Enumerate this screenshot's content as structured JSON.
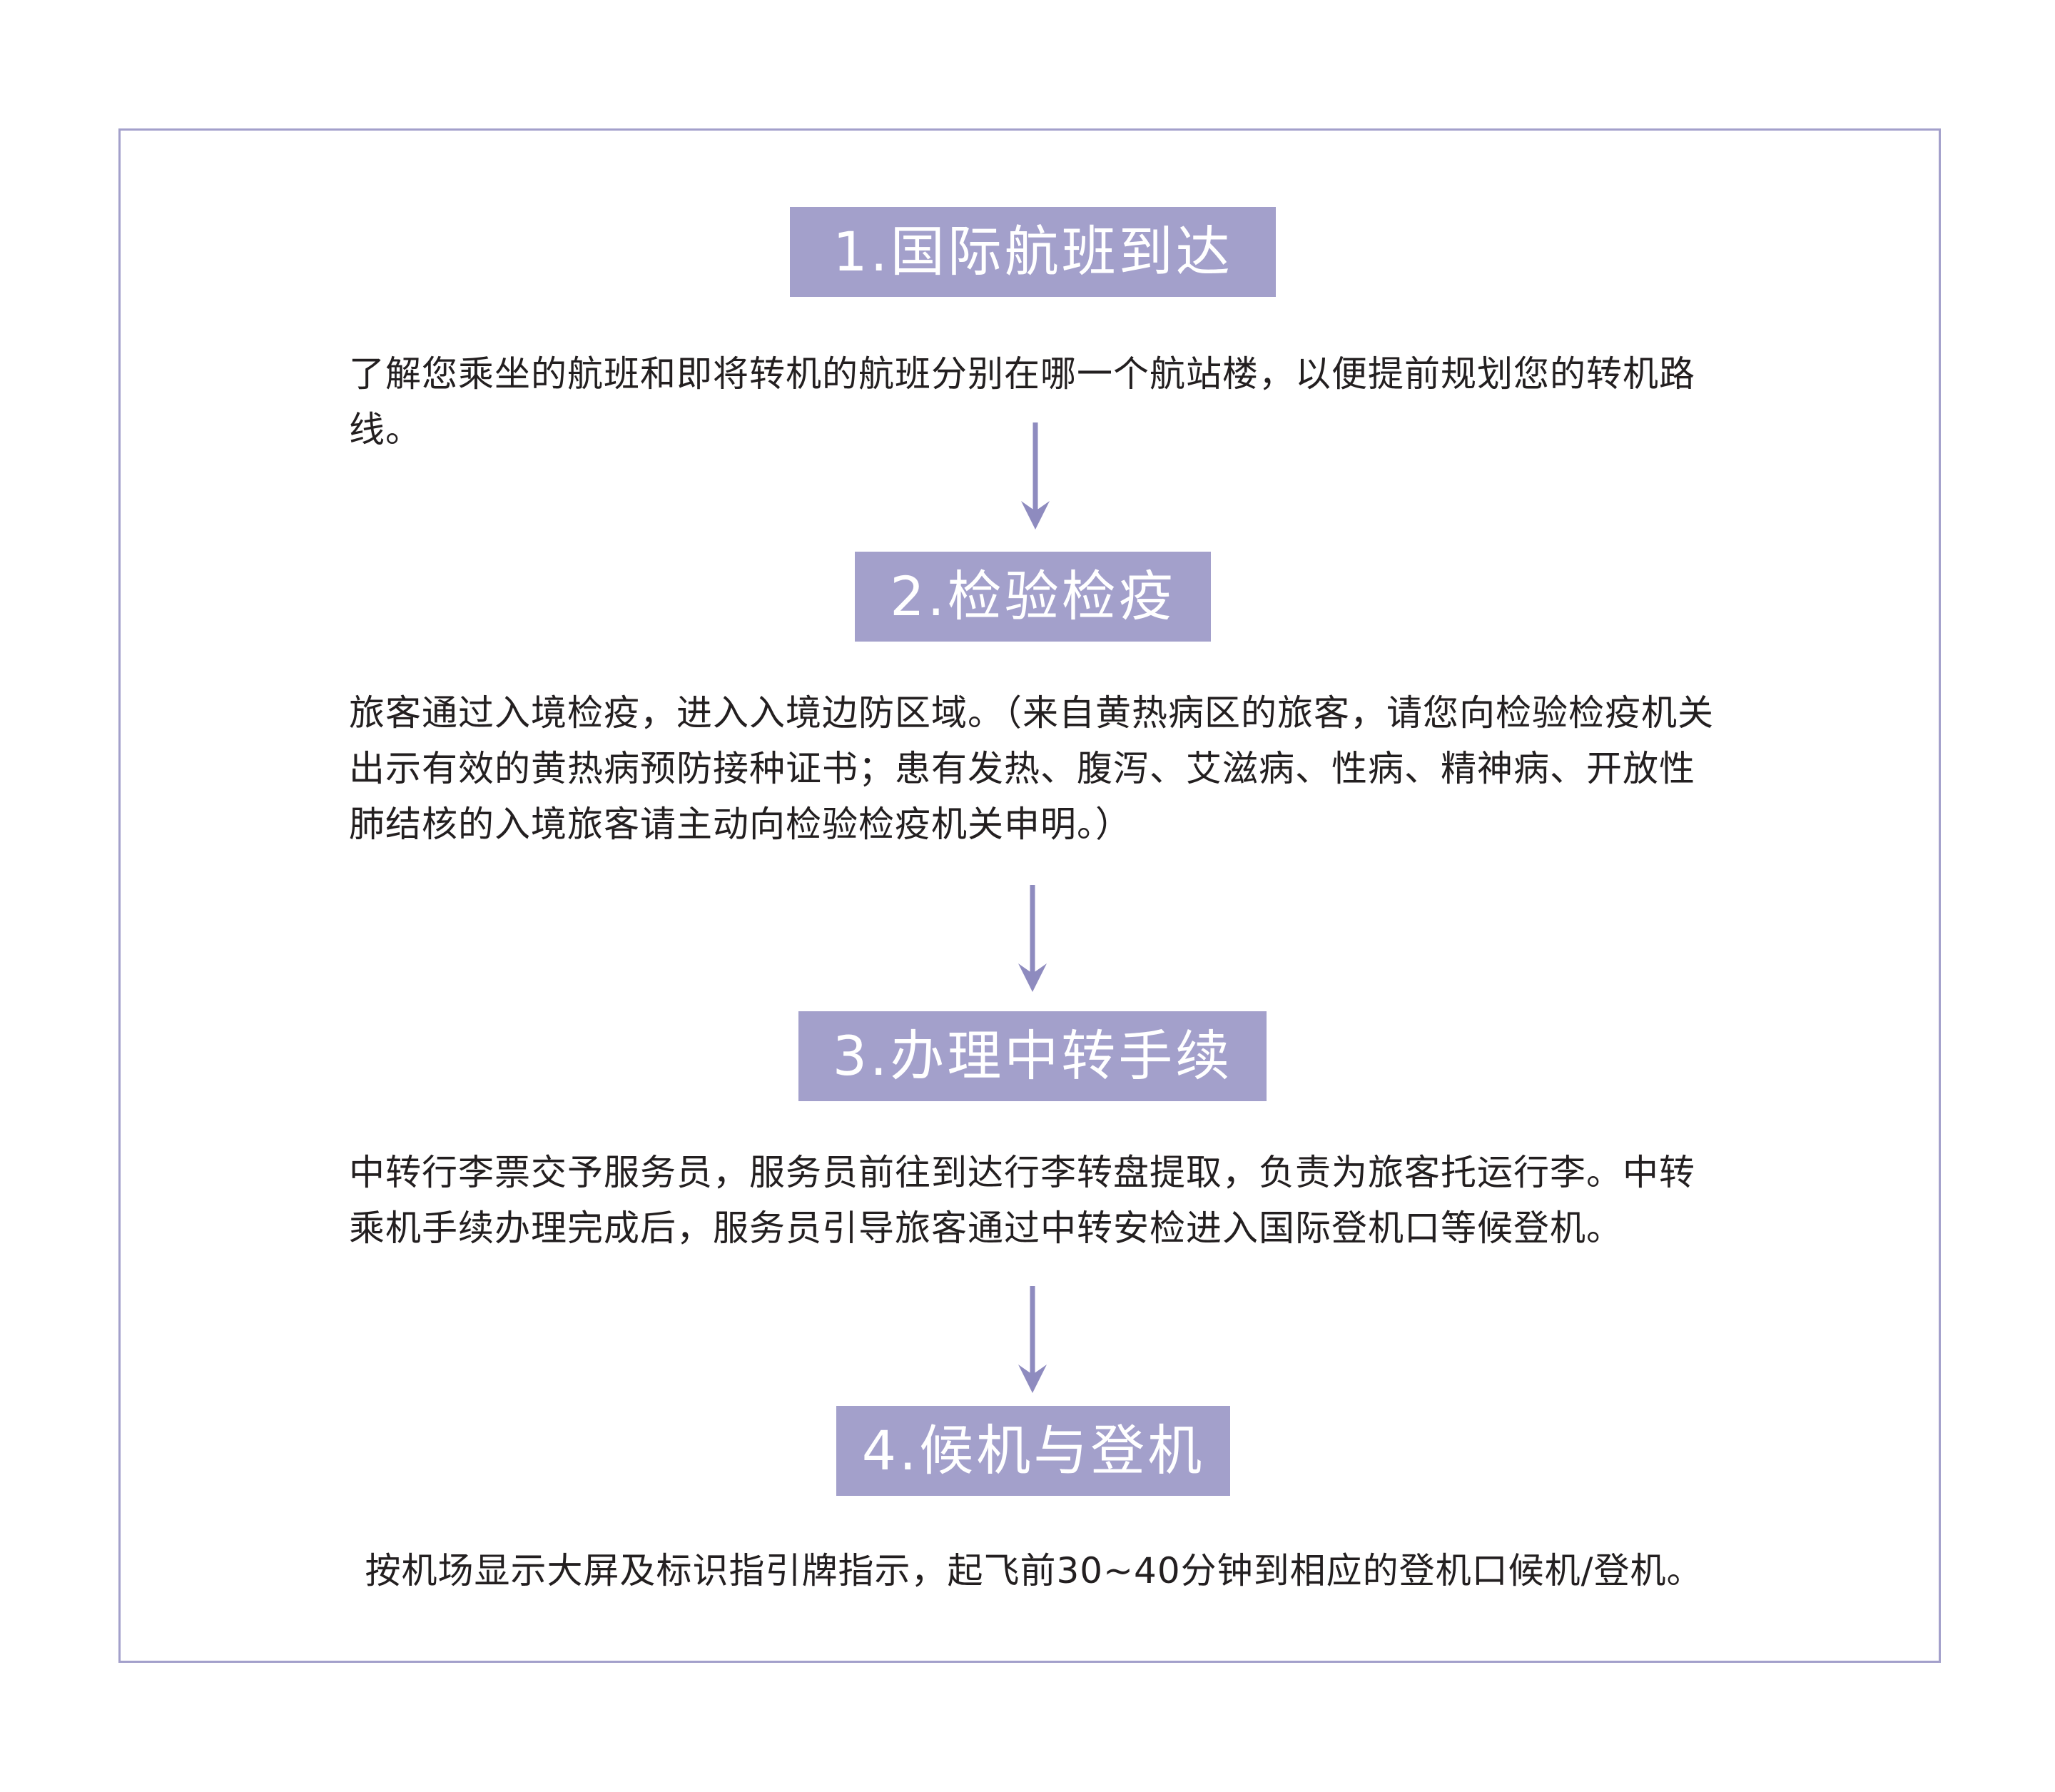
{
  "steps": [
    {
      "title": "1.国际航班到达",
      "description": "了解您乘坐的航班和即将转机的航班分别在哪一个航站楼，以便提前规划您的转机路线。"
    },
    {
      "title": "2.检验检疫",
      "description": "旅客通过入境检疫，进入入境边防区域。（来自黄热病区的旅客，请您向检验检疫机关出示有效的黄热病预防接种证书；患有发热、腹泻、艾滋病、性病、精神病、开放性肺结核的入境旅客请主动向检验检疫机关申明。）"
    },
    {
      "title": "3.办理中转手续",
      "description": "中转行李票交予服务员，服务员前往到达行李转盘提取，负责为旅客托运行李。中转乘机手续办理完成后，服务员引导旅客通过中转安检进入国际登机口等候登机。"
    },
    {
      "title": "4.候机与登机",
      "description": "按机场显示大屏及标识指引牌指示，起飞前30~40分钟到相应的登机口候机/登机。"
    }
  ],
  "colors": {
    "accent": "#a3a0cb",
    "title_text": "#ffffff",
    "body_text": "#231f20",
    "arrow": "#8e8bbf"
  },
  "icons": [
    "arrow-down-icon"
  ]
}
